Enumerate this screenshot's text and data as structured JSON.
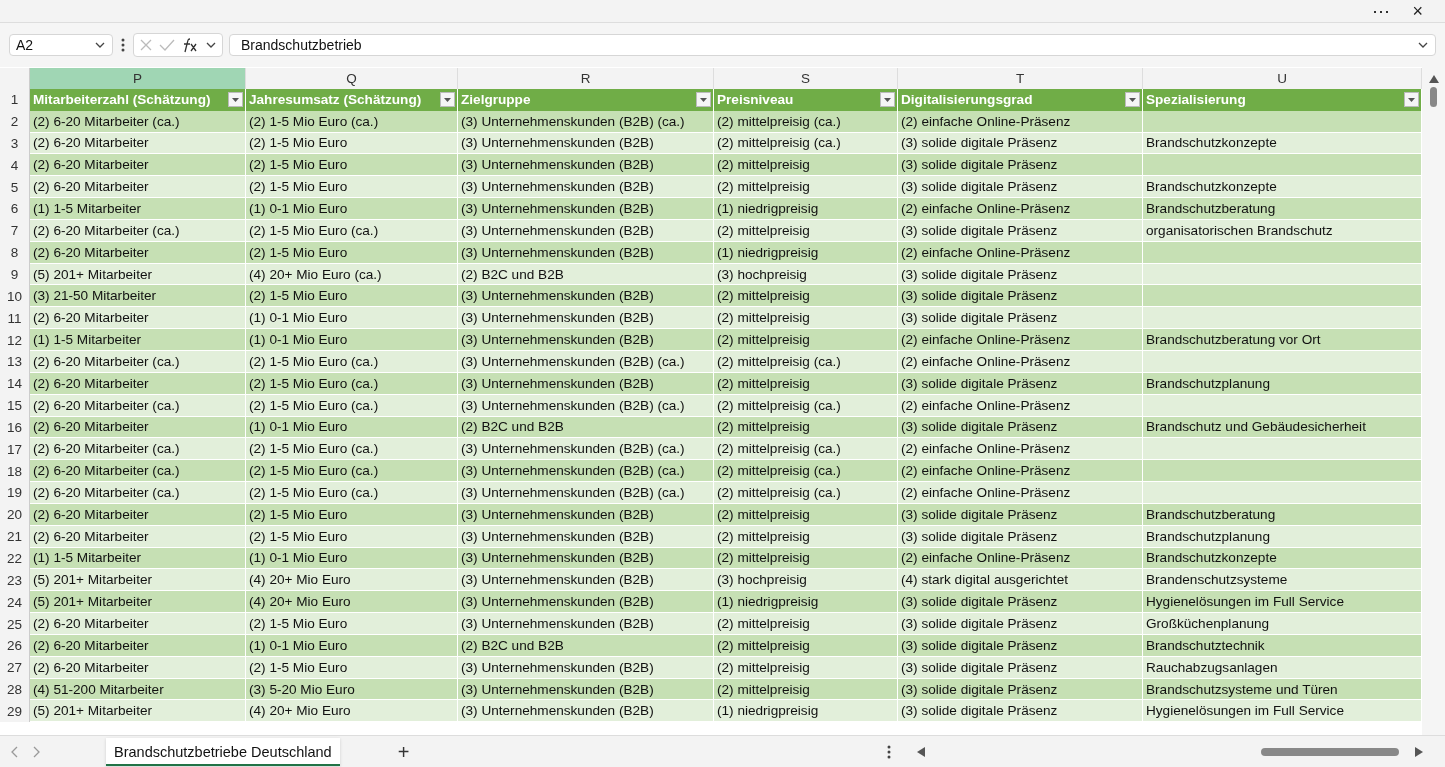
{
  "window": {
    "more": "⋯",
    "close": "×"
  },
  "formula_bar": {
    "name_box": "A2",
    "formula": "Brandschutzbetrieb"
  },
  "columns": [
    {
      "letter": "P",
      "header": "Mitarbeiterzahl (Schätzung)",
      "selected": true
    },
    {
      "letter": "Q",
      "header": "Jahresumsatz (Schätzung)",
      "selected": false
    },
    {
      "letter": "R",
      "header": "Zielgruppe",
      "selected": false
    },
    {
      "letter": "S",
      "header": "Preisniveau",
      "selected": false
    },
    {
      "letter": "T",
      "header": "Digitalisierungsgrad",
      "selected": false
    },
    {
      "letter": "U",
      "header": "Spezialisierung",
      "selected": false
    }
  ],
  "header_row": "1",
  "rows": [
    {
      "num": "2",
      "cells": [
        "(2) 6-20 Mitarbeiter (ca.)",
        "(2) 1-5 Mio Euro (ca.)",
        "(3) Unternehmenskunden (B2B) (ca.)",
        "(2) mittelpreisig (ca.)",
        "(2) einfache Online-Präsenz"
      ]
    },
    {
      "num": "3",
      "cells": [
        "(2) 6-20 Mitarbeiter",
        "(2) 1-5 Mio Euro",
        "(3) Unternehmenskunden (B2B)",
        "(2) mittelpreisig (ca.)",
        "(3) solide digitale Präsenz",
        "Brandschutzkonzepte"
      ]
    },
    {
      "num": "4",
      "cells": [
        "(2) 6-20 Mitarbeiter",
        "(2) 1-5 Mio Euro",
        "(3) Unternehmenskunden (B2B)",
        "(2) mittelpreisig",
        "(3) solide digitale Präsenz"
      ]
    },
    {
      "num": "5",
      "cells": [
        "(2) 6-20 Mitarbeiter",
        "(2) 1-5 Mio Euro",
        "(3) Unternehmenskunden (B2B)",
        "(2) mittelpreisig",
        "(3) solide digitale Präsenz",
        "Brandschutzkonzepte"
      ]
    },
    {
      "num": "6",
      "cells": [
        "(1) 1-5 Mitarbeiter",
        "(1) 0-1 Mio Euro",
        "(3) Unternehmenskunden (B2B)",
        "(1) niedrigpreisig",
        "(2) einfache Online-Präsenz",
        "Brandschutzberatung"
      ]
    },
    {
      "num": "7",
      "cells": [
        "(2) 6-20 Mitarbeiter (ca.)",
        "(2) 1-5 Mio Euro (ca.)",
        "(3) Unternehmenskunden (B2B)",
        "(2) mittelpreisig",
        "(3) solide digitale Präsenz",
        "organisatorischen Brandschutz"
      ]
    },
    {
      "num": "8",
      "cells": [
        "(2) 6-20 Mitarbeiter",
        "(2) 1-5 Mio Euro",
        "(3) Unternehmenskunden (B2B)",
        "(1) niedrigpreisig",
        "(2) einfache Online-Präsenz"
      ]
    },
    {
      "num": "9",
      "cells": [
        "(5) 201+ Mitarbeiter",
        "(4) 20+ Mio Euro (ca.)",
        "(2) B2C und B2B",
        "(3) hochpreisig",
        "(3) solide digitale Präsenz"
      ]
    },
    {
      "num": "10",
      "cells": [
        "(3) 21-50 Mitarbeiter",
        "(2) 1-5 Mio Euro",
        "(3) Unternehmenskunden (B2B)",
        "(2) mittelpreisig",
        "(3) solide digitale Präsenz"
      ]
    },
    {
      "num": "11",
      "cells": [
        "(2) 6-20 Mitarbeiter",
        "(1) 0-1 Mio Euro",
        "(3) Unternehmenskunden (B2B)",
        "(2) mittelpreisig",
        "(3) solide digitale Präsenz"
      ]
    },
    {
      "num": "12",
      "cells": [
        "(1) 1-5 Mitarbeiter",
        "(1) 0-1 Mio Euro",
        "(3) Unternehmenskunden (B2B)",
        "(2) mittelpreisig",
        "(2) einfache Online-Präsenz",
        "Brandschutzberatung vor Ort"
      ]
    },
    {
      "num": "13",
      "cells": [
        "(2) 6-20 Mitarbeiter (ca.)",
        "(2) 1-5 Mio Euro (ca.)",
        "(3) Unternehmenskunden (B2B) (ca.)",
        "(2) mittelpreisig (ca.)",
        "(2) einfache Online-Präsenz"
      ]
    },
    {
      "num": "14",
      "cells": [
        "(2) 6-20 Mitarbeiter",
        "(2) 1-5 Mio Euro (ca.)",
        "(3) Unternehmenskunden (B2B)",
        "(2) mittelpreisig",
        "(3) solide digitale Präsenz",
        "Brandschutzplanung"
      ]
    },
    {
      "num": "15",
      "cells": [
        "(2) 6-20 Mitarbeiter (ca.)",
        "(2) 1-5 Mio Euro (ca.)",
        "(3) Unternehmenskunden (B2B) (ca.)",
        "(2) mittelpreisig (ca.)",
        "(2) einfache Online-Präsenz"
      ]
    },
    {
      "num": "16",
      "cells": [
        "(2) 6-20 Mitarbeiter",
        "(1) 0-1 Mio Euro",
        "(2) B2C und B2B",
        "(2) mittelpreisig",
        "(3) solide digitale Präsenz",
        "Brandschutz und Gebäudesicherheit"
      ]
    },
    {
      "num": "17",
      "cells": [
        "(2) 6-20 Mitarbeiter (ca.)",
        "(2) 1-5 Mio Euro (ca.)",
        "(3) Unternehmenskunden (B2B) (ca.)",
        "(2) mittelpreisig (ca.)",
        "(2) einfache Online-Präsenz"
      ]
    },
    {
      "num": "18",
      "cells": [
        "(2) 6-20 Mitarbeiter (ca.)",
        "(2) 1-5 Mio Euro (ca.)",
        "(3) Unternehmenskunden (B2B) (ca.)",
        "(2) mittelpreisig (ca.)",
        "(2) einfache Online-Präsenz"
      ]
    },
    {
      "num": "19",
      "cells": [
        "(2) 6-20 Mitarbeiter (ca.)",
        "(2) 1-5 Mio Euro (ca.)",
        "(3) Unternehmenskunden (B2B) (ca.)",
        "(2) mittelpreisig (ca.)",
        "(2) einfache Online-Präsenz"
      ]
    },
    {
      "num": "20",
      "cells": [
        "(2) 6-20 Mitarbeiter",
        "(2) 1-5 Mio Euro",
        "(3) Unternehmenskunden (B2B)",
        "(2) mittelpreisig",
        "(3) solide digitale Präsenz",
        "Brandschutzberatung"
      ]
    },
    {
      "num": "21",
      "cells": [
        "(2) 6-20 Mitarbeiter",
        "(2) 1-5 Mio Euro",
        "(3) Unternehmenskunden (B2B)",
        "(2) mittelpreisig",
        "(3) solide digitale Präsenz",
        "Brandschutzplanung"
      ]
    },
    {
      "num": "22",
      "cells": [
        "(1) 1-5 Mitarbeiter",
        "(1) 0-1 Mio Euro",
        "(3) Unternehmenskunden (B2B)",
        "(2) mittelpreisig",
        "(2) einfache Online-Präsenz",
        "Brandschutzkonzepte"
      ]
    },
    {
      "num": "23",
      "cells": [
        "(5) 201+ Mitarbeiter",
        "(4) 20+ Mio Euro",
        "(3) Unternehmenskunden (B2B)",
        "(3) hochpreisig",
        "(4) stark digital ausgerichtet",
        "Brandenschutzsysteme"
      ]
    },
    {
      "num": "24",
      "cells": [
        "(5) 201+ Mitarbeiter",
        "(4) 20+ Mio Euro",
        "(3) Unternehmenskunden (B2B)",
        "(1) niedrigpreisig",
        "(3) solide digitale Präsenz",
        "Hygienelösungen im Full Service"
      ]
    },
    {
      "num": "25",
      "cells": [
        "(2) 6-20 Mitarbeiter",
        "(2) 1-5 Mio Euro",
        "(3) Unternehmenskunden (B2B)",
        "(2) mittelpreisig",
        "(3) solide digitale Präsenz",
        "Großküchenplanung"
      ]
    },
    {
      "num": "26",
      "cells": [
        "(2) 6-20 Mitarbeiter",
        "(1) 0-1 Mio Euro",
        "(2) B2C und B2B",
        "(2) mittelpreisig",
        "(3) solide digitale Präsenz",
        "Brandschutztechnik"
      ]
    },
    {
      "num": "27",
      "cells": [
        "(2) 6-20 Mitarbeiter",
        "(2) 1-5 Mio Euro",
        "(3) Unternehmenskunden (B2B)",
        "(2) mittelpreisig",
        "(3) solide digitale Präsenz",
        "Rauchabzugsanlagen"
      ]
    },
    {
      "num": "28",
      "cells": [
        "(4) 51-200 Mitarbeiter",
        "(3) 5-20 Mio Euro",
        "(3) Unternehmenskunden (B2B)",
        "(2) mittelpreisig",
        "(3) solide digitale Präsenz",
        "Brandschutzsysteme und Türen"
      ]
    },
    {
      "num": "29",
      "cells": [
        "(5) 201+ Mitarbeiter",
        "(4) 20+ Mio Euro",
        "(3) Unternehmenskunden (B2B)",
        "(1) niedrigpreisig",
        "(3) solide digitale Präsenz",
        "Hygienelösungen im Full Service"
      ]
    }
  ],
  "sheet_tabs": [
    {
      "label": "Brandschutzbetriebe Deutschland",
      "selected": true
    }
  ],
  "add_sheet": "+"
}
